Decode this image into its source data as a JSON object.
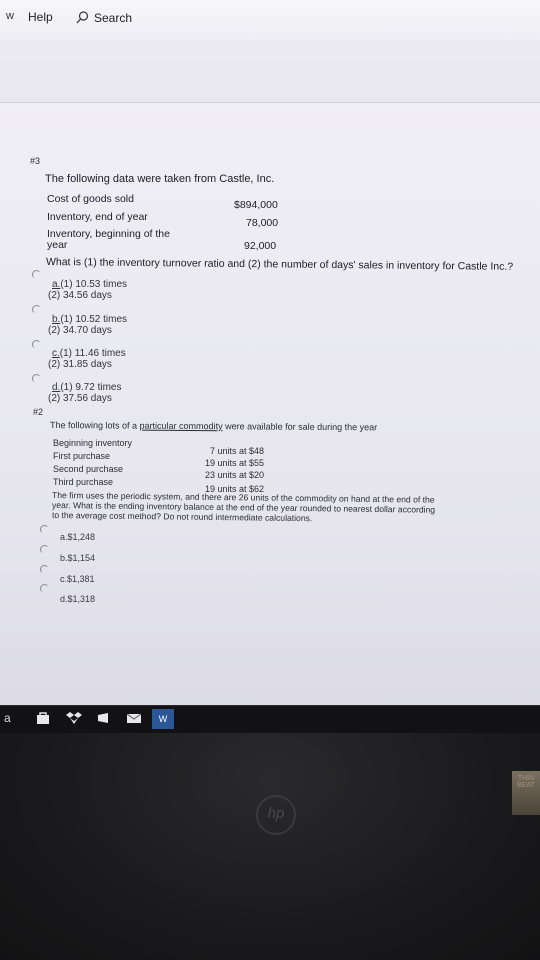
{
  "menubar": {
    "w_label": "w",
    "help_label": "Help",
    "search_label": "Search"
  },
  "q3": {
    "number": "#3",
    "intro": "The following data were taken from Castle, Inc.",
    "rows": [
      {
        "label": "Cost of goods sold",
        "value": "$894,000"
      },
      {
        "label": "Inventory, end of year",
        "value": "78,000"
      },
      {
        "label": "Inventory, beginning of the",
        "label2": "year",
        "value": "92,000"
      }
    ],
    "question": "What is (1) the inventory turnover ratio and (2) the number of days' sales in inventory for Castle Inc.?",
    "options": [
      {
        "letter": "a.",
        "line1": "(1) 10.53 times",
        "line2": "(2) 34.56 days"
      },
      {
        "letter": "b.",
        "line1": "(1) 10.52 times",
        "line2": "(2) 34.70 days"
      },
      {
        "letter": "c.",
        "line1": "(1) 11.46 times",
        "line2": "(2) 31.85 days"
      },
      {
        "letter": "d.",
        "line1": "(1) 9.72 times",
        "line2": "(2) 37.56 days"
      }
    ]
  },
  "q2": {
    "number": "#2",
    "intro_a": "The following lots of a ",
    "intro_link": "particular commodity",
    "intro_b": " were available for sale during the year",
    "rows": [
      {
        "label": "Beginning inventory",
        "value": "7 units at $48"
      },
      {
        "label": "First purchase",
        "value": "19 units at $55"
      },
      {
        "label": "Second purchase",
        "value": "23 units at $20"
      },
      {
        "label": "Third purchase",
        "value": "19 units at $62"
      }
    ],
    "body1": "The firm uses the periodic system, and there are 26 units of the commodity on hand at the end of the",
    "body2": "year. What is the ending inventory balance at the end of the year rounded to nearest dollar according",
    "body3": "to the average cost method? Do not round intermediate calculations.",
    "options": [
      {
        "text": "a.$1,248"
      },
      {
        "text": "b.$1,154"
      },
      {
        "text": "c.$1,381"
      },
      {
        "text": "d.$1,318"
      }
    ]
  },
  "taskbar": {
    "start_letter": "a",
    "app_label": "W"
  },
  "bezel": {
    "logo": "hp",
    "sticker": "THIN BEAT"
  }
}
